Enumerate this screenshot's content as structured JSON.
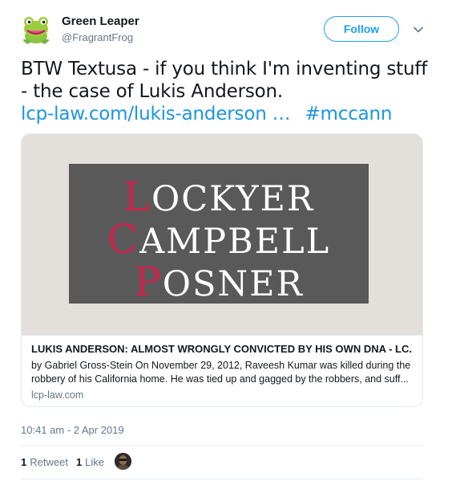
{
  "author": {
    "name": "Green Leaper",
    "handle": "@FragrantFrog",
    "avatar_icon": "frog-icon"
  },
  "follow_button": {
    "label": "Follow"
  },
  "tweet": {
    "line1": "BTW Textusa - if you think I'm inventing stuff",
    "line2": "- the case of Lukis Anderson.",
    "link_text": "lcp-law.com/lukis-anderson …",
    "hashtag": "#mccann"
  },
  "card": {
    "logo": {
      "line1_initial": "L",
      "line1_rest": "OCKYER",
      "line2_initial": "C",
      "line2_rest": "AMPBELL",
      "line3_initial": "P",
      "line3_rest": "OSNER"
    },
    "title": "LUKIS ANDERSON: ALMOST WRONGLY CONVICTED BY HIS OWN DNA - LC...",
    "description_line1": "by Gabriel Gross-Stein On November 29, 2012, Raveesh Kumar was killed during the",
    "description_line2": "robbery of his California home. He was tied up and gagged by the robbers, and suff...",
    "domain": "lcp-law.com"
  },
  "timestamp": "10:41 am - 2 Apr 2019",
  "stats": {
    "retweets_count": "1",
    "retweets_label": "Retweet",
    "likes_count": "1",
    "likes_label": "Like"
  },
  "colors": {
    "accent": "#1da1f2",
    "logo_red": "#c8244e",
    "logo_bg": "#595959",
    "muted": "#657786"
  }
}
